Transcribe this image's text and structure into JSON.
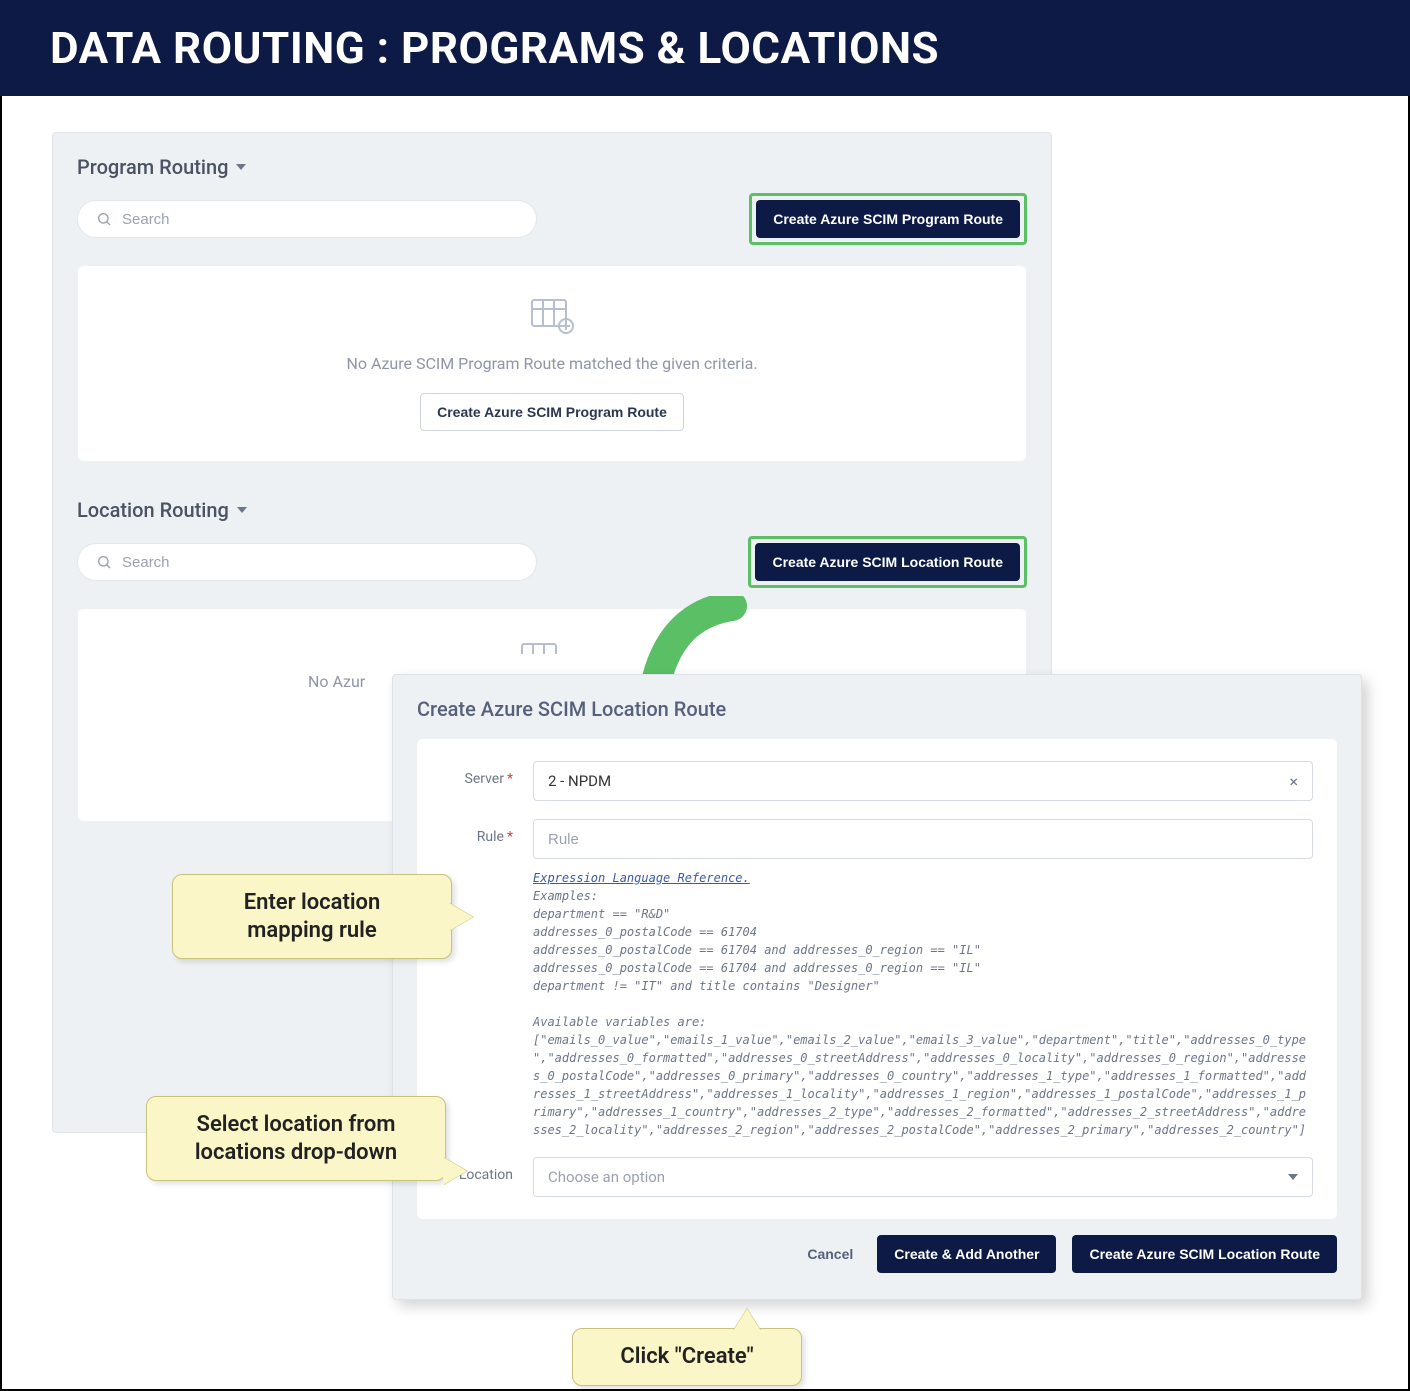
{
  "banner": {
    "title": "DATA ROUTING : PROGRAMS & LOCATIONS"
  },
  "panel": {
    "program": {
      "title": "Program Routing",
      "search_placeholder": "Search",
      "create_btn": "Create Azure SCIM Program Route",
      "empty_msg": "No Azure SCIM Program Route matched the given criteria.",
      "empty_create_btn": "Create Azure SCIM Program Route"
    },
    "location": {
      "title": "Location Routing",
      "search_placeholder": "Search",
      "create_btn": "Create Azure SCIM Location Route",
      "empty_msg_prefix": "No Azur"
    }
  },
  "modal": {
    "title": "Create Azure SCIM Location Route",
    "server": {
      "label": "Server",
      "value": "2 - NPDM"
    },
    "rule": {
      "label": "Rule",
      "placeholder": "Rule",
      "help_link": "Expression Language Reference.",
      "help_examples_heading": "Examples:",
      "help_examples": "department == \"R&D\"\naddresses_0_postalCode == 61704\naddresses_0_postalCode == 61704 and addresses_0_region == \"IL\"\naddresses_0_postalCode == 61704 and addresses_0_region == \"IL\"\ndepartment != \"IT\" and title contains \"Designer\"",
      "help_vars": "Available variables are: [\"emails_0_value\",\"emails_1_value\",\"emails_2_value\",\"emails_3_value\",\"department\",\"title\",\"addresses_0_type\",\"addresses_0_formatted\",\"addresses_0_streetAddress\",\"addresses_0_locality\",\"addresses_0_region\",\"addresses_0_postalCode\",\"addresses_0_primary\",\"addresses_0_country\",\"addresses_1_type\",\"addresses_1_formatted\",\"addresses_1_streetAddress\",\"addresses_1_locality\",\"addresses_1_region\",\"addresses_1_postalCode\",\"addresses_1_primary\",\"addresses_1_country\",\"addresses_2_type\",\"addresses_2_formatted\",\"addresses_2_streetAddress\",\"addresses_2_locality\",\"addresses_2_region\",\"addresses_2_postalCode\",\"addresses_2_primary\",\"addresses_2_country\"]"
    },
    "location": {
      "label": "Location",
      "placeholder": "Choose an option"
    },
    "footer": {
      "cancel": "Cancel",
      "create_another": "Create & Add Another",
      "create": "Create Azure SCIM Location Route"
    }
  },
  "callouts": {
    "c1": "Enter location mapping rule",
    "c2": "Select location from locations drop-down",
    "c3": "Click \"Create\""
  }
}
